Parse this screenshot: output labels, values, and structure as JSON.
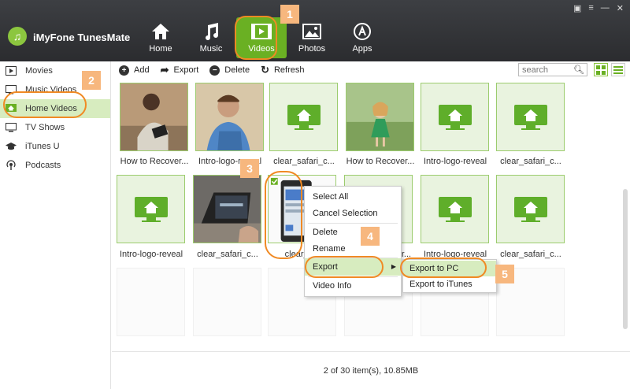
{
  "app": {
    "title": "iMyFone TunesMate"
  },
  "nav": [
    {
      "label": "Home",
      "icon": "home-icon"
    },
    {
      "label": "Music",
      "icon": "music-icon"
    },
    {
      "label": "Videos",
      "icon": "videos-icon"
    },
    {
      "label": "Photos",
      "icon": "photos-icon"
    },
    {
      "label": "Apps",
      "icon": "apps-icon"
    }
  ],
  "sidebar": [
    {
      "label": "Movies",
      "icon": "movies-icon"
    },
    {
      "label": "Music Videos",
      "icon": "music-videos-icon"
    },
    {
      "label": "Home Videos",
      "icon": "home-videos-icon"
    },
    {
      "label": "TV Shows",
      "icon": "tv-icon"
    },
    {
      "label": "iTunes U",
      "icon": "graduation-cap-icon"
    },
    {
      "label": "Podcasts",
      "icon": "podcast-icon"
    }
  ],
  "toolbar": {
    "add": "Add",
    "export": "Export",
    "delete": "Delete",
    "refresh": "Refresh"
  },
  "search": {
    "placeholder": "search"
  },
  "videos": [
    {
      "label": "How to Recover...",
      "thumb": "woman-tablet"
    },
    {
      "label": "Intro-logo-reveal",
      "thumb": "man-laptop"
    },
    {
      "label": "clear_safari_c...",
      "thumb": "placeholder"
    },
    {
      "label": "How to Recover...",
      "thumb": "girl-field"
    },
    {
      "label": "Intro-logo-reveal",
      "thumb": "placeholder"
    },
    {
      "label": "clear_safari_c...",
      "thumb": "placeholder"
    },
    {
      "label": "Intro-logo-reveal",
      "thumb": "placeholder"
    },
    {
      "label": "clear_safari_c...",
      "thumb": "laptop-desk"
    },
    {
      "label": "clear_saf",
      "thumb": "ipad"
    },
    {
      "label": "r...",
      "thumb": "placeholder"
    },
    {
      "label": "Intro-logo-reveal",
      "thumb": "placeholder"
    },
    {
      "label": "clear_safari_c...",
      "thumb": "placeholder"
    }
  ],
  "context_menu": {
    "select_all": "Select All",
    "cancel_selection": "Cancel Selection",
    "delete": "Delete",
    "rename": "Rename",
    "export": "Export",
    "video_info": "Video Info"
  },
  "submenu": {
    "export_pc": "Export to PC",
    "export_itunes": "Export to iTunes"
  },
  "status": "2 of 30 item(s), 10.85MB",
  "annotations": [
    "1",
    "2",
    "3",
    "4",
    "5"
  ],
  "colors": {
    "accent": "#6ab023",
    "annotation": "#f08a24",
    "badge": "#f7b77e",
    "selected_bg": "#d7ecbf"
  }
}
